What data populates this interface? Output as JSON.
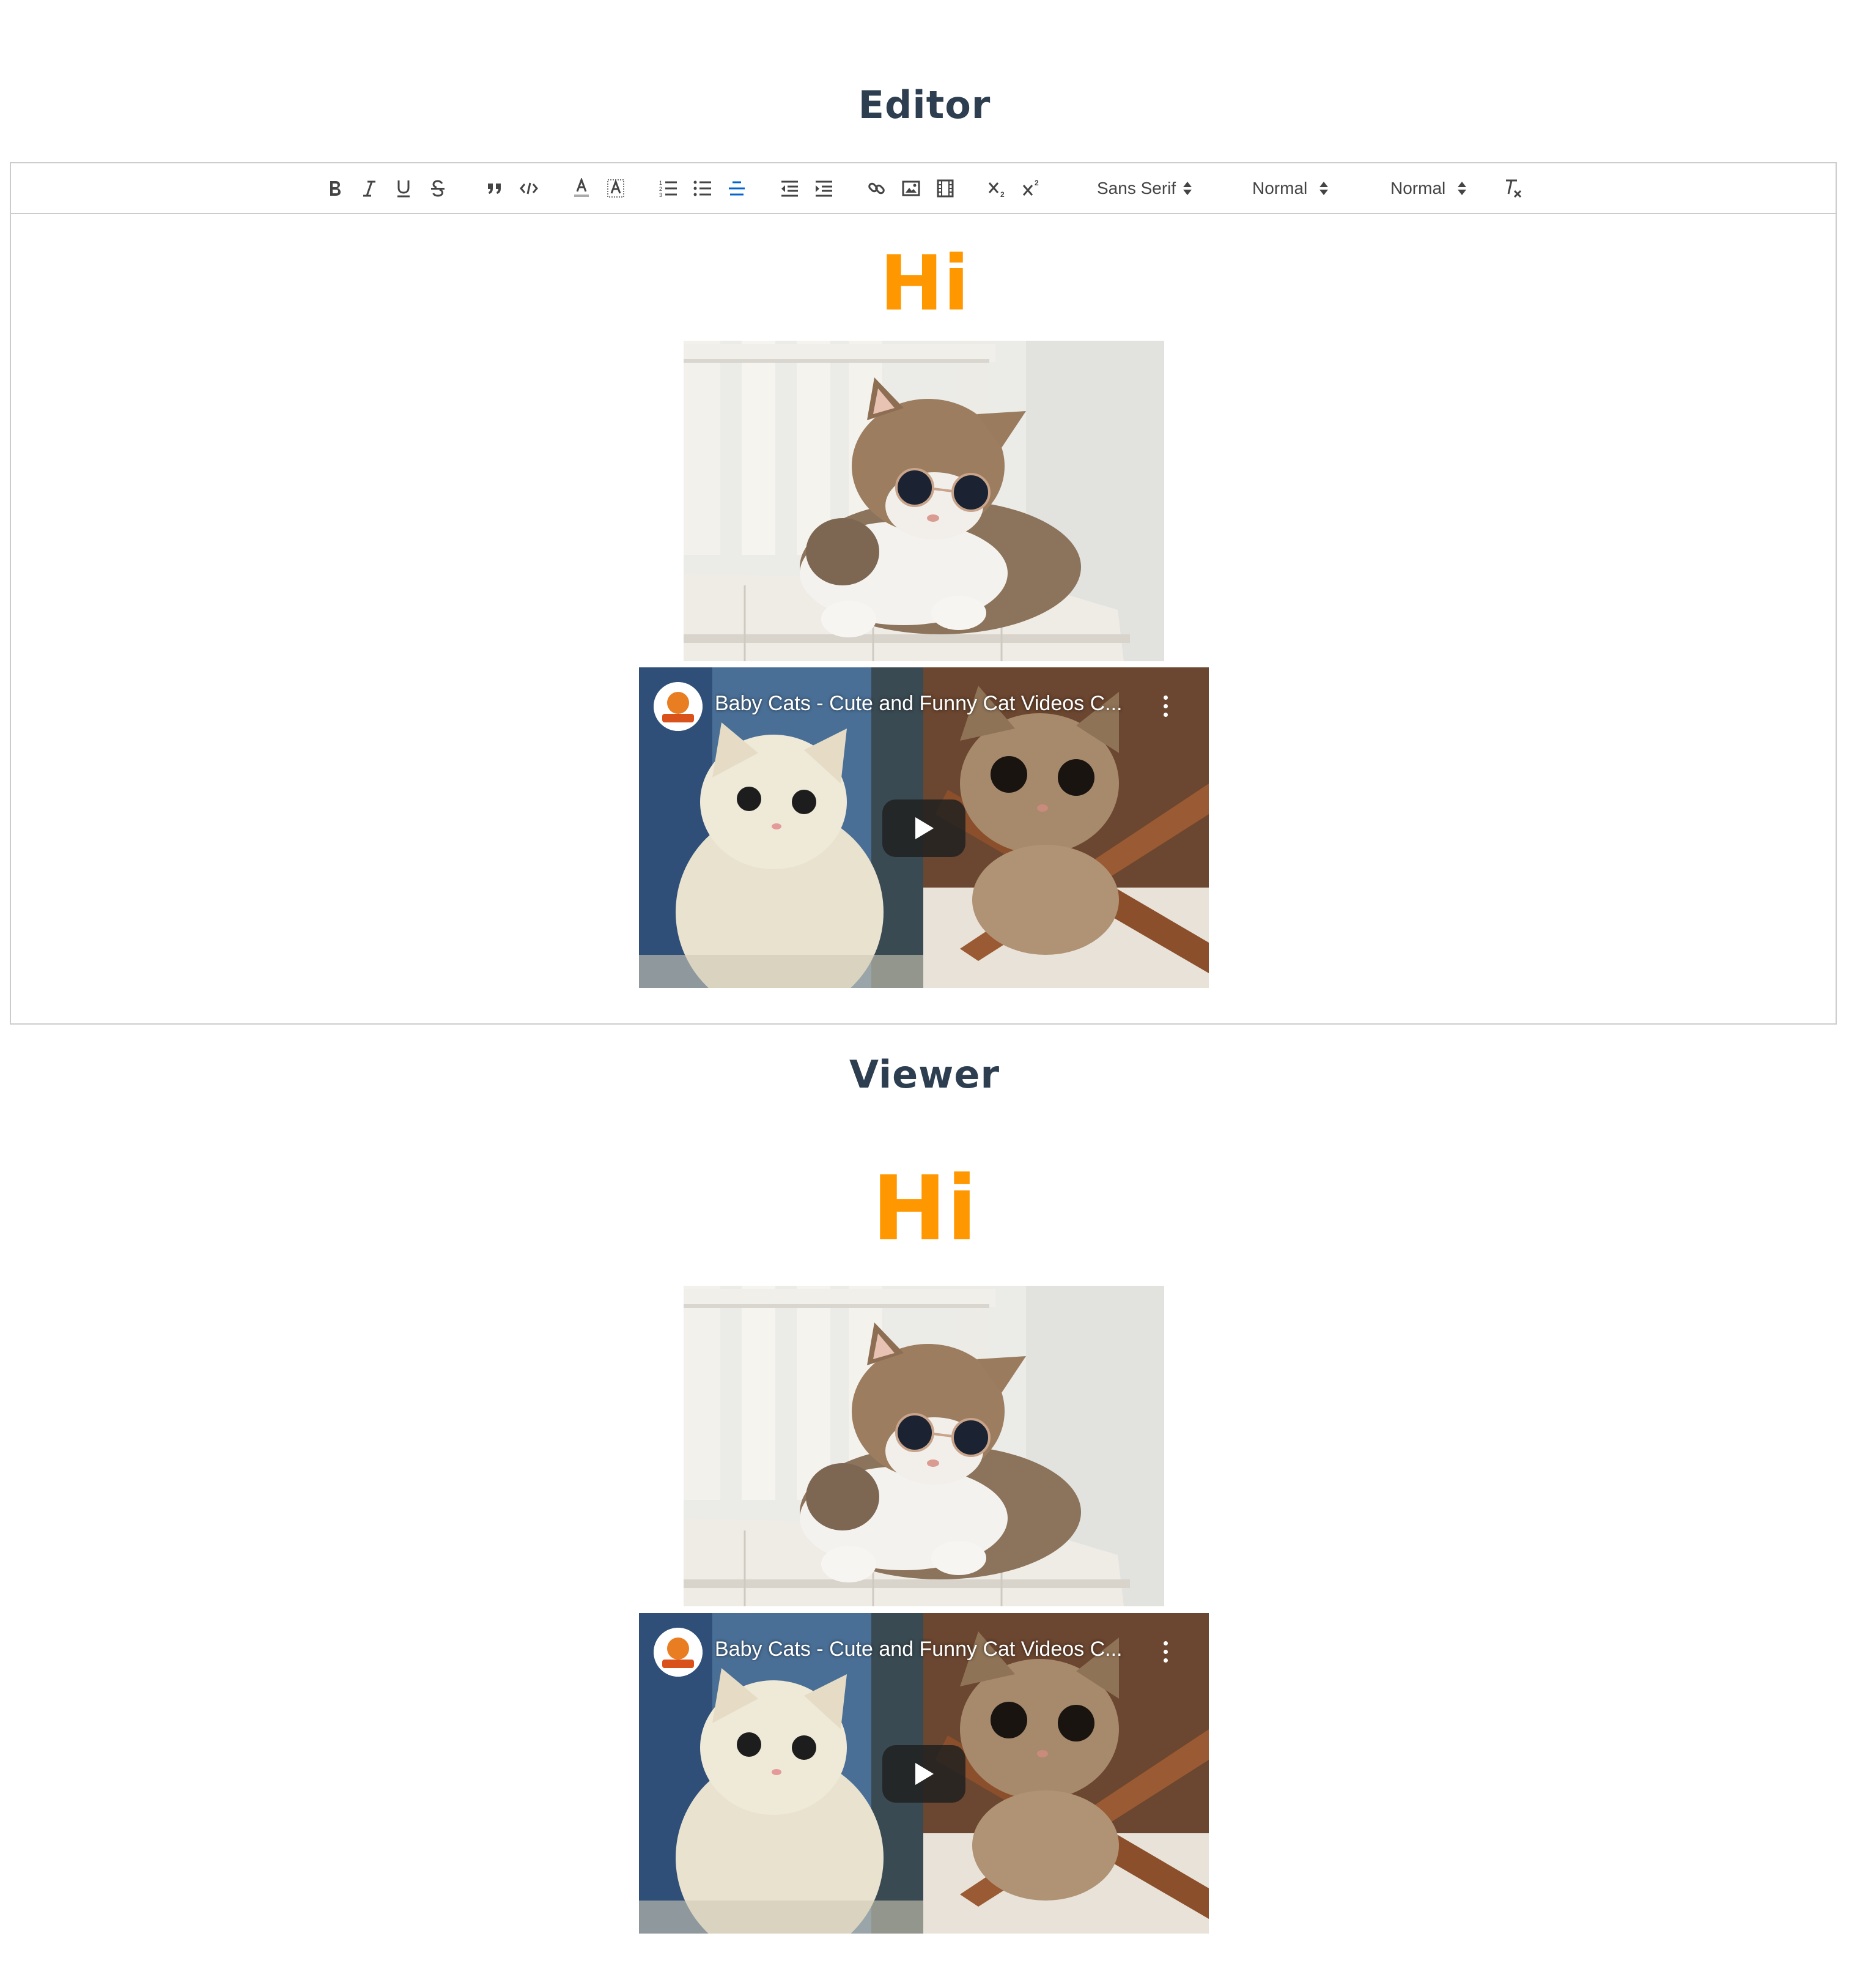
{
  "editor_section": {
    "title": "Editor"
  },
  "viewer_section": {
    "title": "Viewer"
  },
  "toolbar": {
    "bold": "B",
    "italic": "I",
    "underline": "U",
    "strike": "S",
    "font_picker": "Sans Serif",
    "size_picker": "Normal",
    "header_picker": "Normal",
    "active_button": "align-center"
  },
  "content": {
    "heading": "Hi",
    "heading_color": "#ff9800",
    "video_title": "Baby Cats - Cute and Funny Cat Videos C..."
  },
  "colors": {
    "title_text": "#2c3e50",
    "border": "#cccccc",
    "active_icon": "#0066cc"
  }
}
